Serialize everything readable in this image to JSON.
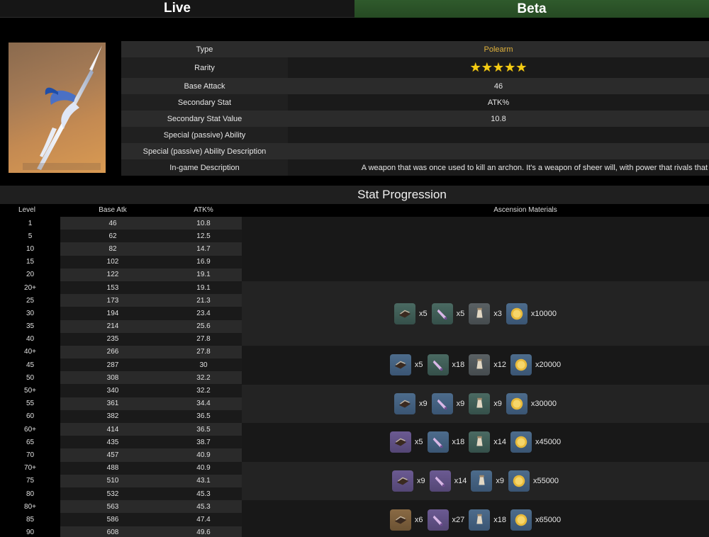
{
  "tabs": {
    "live": "Live",
    "beta": "Beta"
  },
  "info": {
    "type_label": "Type",
    "type_value": "Polearm",
    "rarity_label": "Rarity",
    "rarity_stars": "★★★★★",
    "base_attack_label": "Base Attack",
    "base_attack_value": "46",
    "secondary_stat_label": "Secondary Stat",
    "secondary_stat_value": "ATK%",
    "secondary_value_label": "Secondary Stat Value",
    "secondary_value_value": "10.8",
    "ability_label": "Special (passive) Ability",
    "ability_value": "",
    "ability_desc_label": "Special (passive) Ability Description",
    "ability_desc_value": "",
    "ingame_desc_label": "In-game Description",
    "ingame_desc_value": "A weapon that was once used to kill an archon. It's a weapon of sheer will, with power that rivals that"
  },
  "progression": {
    "title": "Stat Progression",
    "headers": {
      "level": "Level",
      "base_atk": "Base Atk",
      "substat": "ATK%",
      "materials": "Ascension Materials"
    },
    "rows": [
      [
        "1",
        "46",
        "10.8"
      ],
      [
        "5",
        "62",
        "12.5"
      ],
      [
        "10",
        "82",
        "14.7"
      ],
      [
        "15",
        "102",
        "16.9"
      ],
      [
        "20",
        "122",
        "19.1"
      ],
      [
        "20+",
        "153",
        "19.1"
      ],
      [
        "25",
        "173",
        "21.3"
      ],
      [
        "30",
        "194",
        "23.4"
      ],
      [
        "35",
        "214",
        "25.6"
      ],
      [
        "40",
        "235",
        "27.8"
      ],
      [
        "40+",
        "266",
        "27.8"
      ],
      [
        "45",
        "287",
        "30"
      ],
      [
        "50",
        "308",
        "32.2"
      ],
      [
        "50+",
        "340",
        "32.2"
      ],
      [
        "55",
        "361",
        "34.4"
      ],
      [
        "60",
        "382",
        "36.5"
      ],
      [
        "60+",
        "414",
        "36.5"
      ],
      [
        "65",
        "435",
        "38.7"
      ],
      [
        "70",
        "457",
        "40.9"
      ],
      [
        "70+",
        "488",
        "40.9"
      ],
      [
        "75",
        "510",
        "43.1"
      ],
      [
        "80",
        "532",
        "45.3"
      ],
      [
        "80+",
        "563",
        "45.3"
      ],
      [
        "85",
        "586",
        "47.4"
      ],
      [
        "90",
        "608",
        "49.6"
      ]
    ],
    "ascensions": [
      {
        "materials": [
          {
            "icon": "weapon-material-icon",
            "color": "green",
            "qty": "x5"
          },
          {
            "icon": "elite-drop-icon",
            "color": "green",
            "qty": "x5"
          },
          {
            "icon": "common-drop-icon",
            "color": "grey",
            "qty": "x3"
          },
          {
            "icon": "mora-coin-icon",
            "color": "blue",
            "qty": "x10000"
          }
        ]
      },
      {
        "materials": [
          {
            "icon": "weapon-material-icon",
            "color": "blue",
            "qty": "x5"
          },
          {
            "icon": "elite-drop-icon",
            "color": "green",
            "qty": "x18"
          },
          {
            "icon": "common-drop-icon",
            "color": "grey",
            "qty": "x12"
          },
          {
            "icon": "mora-coin-icon",
            "color": "blue",
            "qty": "x20000"
          }
        ]
      },
      {
        "materials": [
          {
            "icon": "weapon-material-icon",
            "color": "blue",
            "qty": "x9"
          },
          {
            "icon": "elite-drop-icon",
            "color": "blue",
            "qty": "x9"
          },
          {
            "icon": "common-drop-icon",
            "color": "green",
            "qty": "x9"
          },
          {
            "icon": "mora-coin-icon",
            "color": "blue",
            "qty": "x30000"
          }
        ]
      },
      {
        "materials": [
          {
            "icon": "weapon-material-icon",
            "color": "purple",
            "qty": "x5"
          },
          {
            "icon": "elite-drop-icon",
            "color": "blue",
            "qty": "x18"
          },
          {
            "icon": "common-drop-icon",
            "color": "green",
            "qty": "x14"
          },
          {
            "icon": "mora-coin-icon",
            "color": "blue",
            "qty": "x45000"
          }
        ]
      },
      {
        "materials": [
          {
            "icon": "weapon-material-icon",
            "color": "purple",
            "qty": "x9"
          },
          {
            "icon": "elite-drop-icon",
            "color": "purple",
            "qty": "x14"
          },
          {
            "icon": "common-drop-icon",
            "color": "blue",
            "qty": "x9"
          },
          {
            "icon": "mora-coin-icon",
            "color": "blue",
            "qty": "x55000"
          }
        ]
      },
      {
        "materials": [
          {
            "icon": "weapon-material-icon",
            "color": "gold",
            "qty": "x6"
          },
          {
            "icon": "elite-drop-icon",
            "color": "purple",
            "qty": "x27"
          },
          {
            "icon": "common-drop-icon",
            "color": "blue",
            "qty": "x18"
          },
          {
            "icon": "mora-coin-icon",
            "color": "blue",
            "qty": "x65000"
          }
        ]
      }
    ]
  },
  "colors": {
    "beta_tab": "#2f5a2c",
    "type_accent": "#e0b23c",
    "star": "#f4cc14"
  }
}
